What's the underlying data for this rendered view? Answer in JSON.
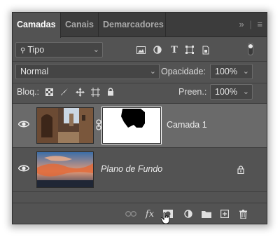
{
  "tabs": [
    {
      "label": "Camadas",
      "active": true
    },
    {
      "label": "Canais",
      "active": false
    },
    {
      "label": "Demarcadores",
      "active": false
    }
  ],
  "panel_menu": {
    "collapse": "»",
    "menu": "≡"
  },
  "filter": {
    "kind_label": "Tipo"
  },
  "blend": {
    "mode": "Normal",
    "opacity_label": "Opacidade:",
    "opacity_value": "100%"
  },
  "lock": {
    "label": "Bloq.:",
    "fill_label": "Preen.:",
    "fill_value": "100%"
  },
  "layers": [
    {
      "name": "Camada 1",
      "selected": true,
      "has_mask": true
    },
    {
      "name": "Plano de Fundo",
      "selected": false,
      "locked": true
    }
  ],
  "footer": {
    "fx_label": "fx"
  },
  "colors": {
    "panel": "#535353",
    "tabbar": "#3c3c3c",
    "selected_layer": "#6a6a6a"
  }
}
